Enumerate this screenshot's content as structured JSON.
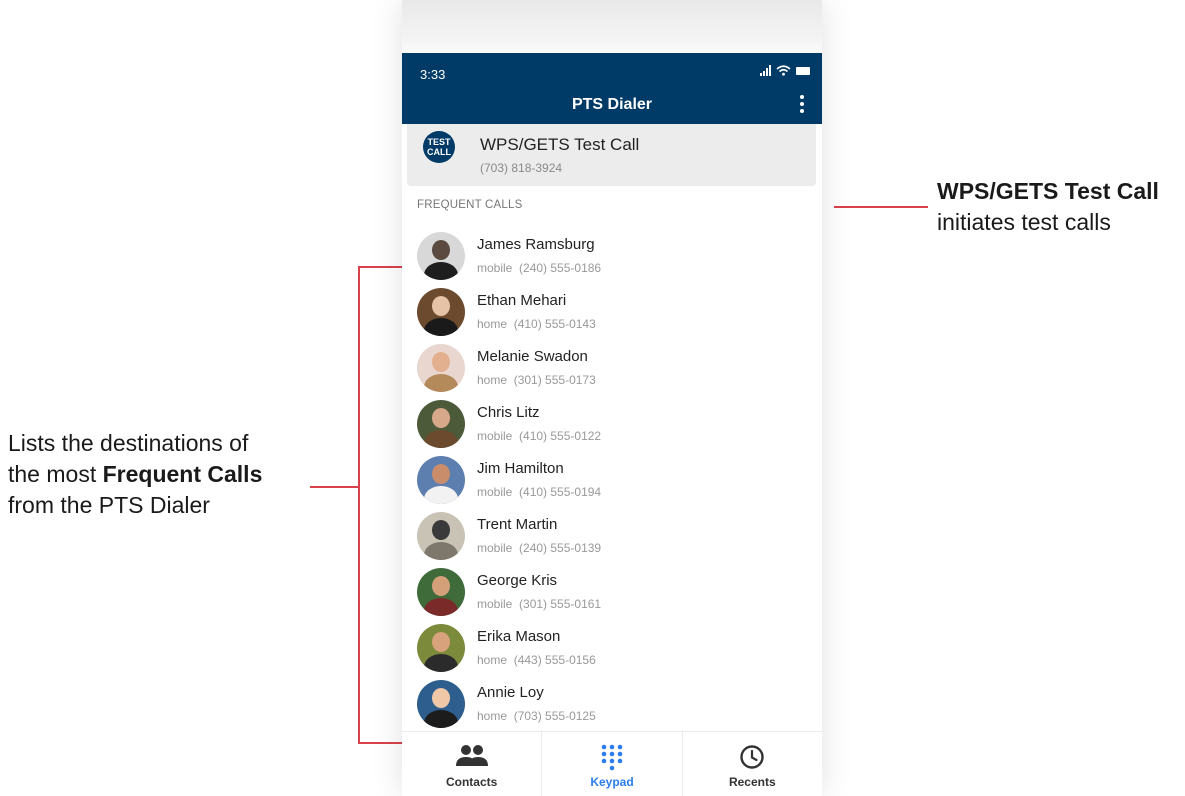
{
  "annotations": {
    "left": {
      "line1": "Lists the destinations of",
      "line2_prefix": "the most ",
      "line2_bold": "Frequent Calls",
      "line3": "from the PTS Dialer"
    },
    "right": {
      "bold": "WPS/GETS Test Call",
      "rest": "initiates test calls"
    },
    "accent_color": "#d9424a"
  },
  "status_bar": {
    "time": "3:33"
  },
  "app": {
    "title": "PTS Dialer",
    "bar_color": "#003a66",
    "menu_icon": "kebab-menu-icon"
  },
  "test_call": {
    "badge_line1": "TEST",
    "badge_line2": "CALL",
    "title": "WPS/GETS Test Call",
    "number": "(703) 818-3924"
  },
  "frequent": {
    "header": "FREQUENT CALLS",
    "contacts": [
      {
        "name": "James Ramsburg",
        "type": "mobile",
        "number": "(240) 555-0186",
        "bg": "#d8d8d8",
        "skin": "#5a4a40",
        "shirt": "#1e1e1e"
      },
      {
        "name": "Ethan Mehari",
        "type": "home",
        "number": "(410) 555-0143",
        "bg": "#6b4a2e",
        "skin": "#e6c2a6",
        "shirt": "#1a1a1a"
      },
      {
        "name": "Melanie Swadon",
        "type": "home",
        "number": "(301) 555-0173",
        "bg": "#e9d6cf",
        "skin": "#e2b08f",
        "shirt": "#b58a5a"
      },
      {
        "name": "Chris Litz",
        "type": "mobile",
        "number": "(410) 555-0122",
        "bg": "#4d5a3a",
        "skin": "#d7a98a",
        "shirt": "#6b4a2e"
      },
      {
        "name": "Jim Hamilton",
        "type": "mobile",
        "number": "(410) 555-0194",
        "bg": "#5d7fb0",
        "skin": "#c98d6c",
        "shirt": "#f2f2f2"
      },
      {
        "name": "Trent Martin",
        "type": "mobile",
        "number": "(240) 555-0139",
        "bg": "#c9c3b6",
        "skin": "#3a3a3a",
        "shirt": "#7e776c"
      },
      {
        "name": "George Kris",
        "type": "mobile",
        "number": "(301) 555-0161",
        "bg": "#3f6b3a",
        "skin": "#d4a07a",
        "shirt": "#7b2a2a"
      },
      {
        "name": "Erika Mason",
        "type": "home",
        "number": "(443) 555-0156",
        "bg": "#7c8a3c",
        "skin": "#d7a27c",
        "shirt": "#2b2b2b"
      },
      {
        "name": "Annie Loy",
        "type": "home",
        "number": "(703) 555-0125",
        "bg": "#2d5e8e",
        "skin": "#f0c8a8",
        "shirt": "#1c1c1c"
      }
    ]
  },
  "bottom_nav": {
    "contacts": {
      "label": "Contacts",
      "icon": "people-icon"
    },
    "keypad": {
      "label": "Keypad",
      "icon": "dialpad-icon"
    },
    "recents": {
      "label": "Recents",
      "icon": "clock-icon"
    },
    "active": "keypad",
    "active_color": "#2b7de9"
  }
}
